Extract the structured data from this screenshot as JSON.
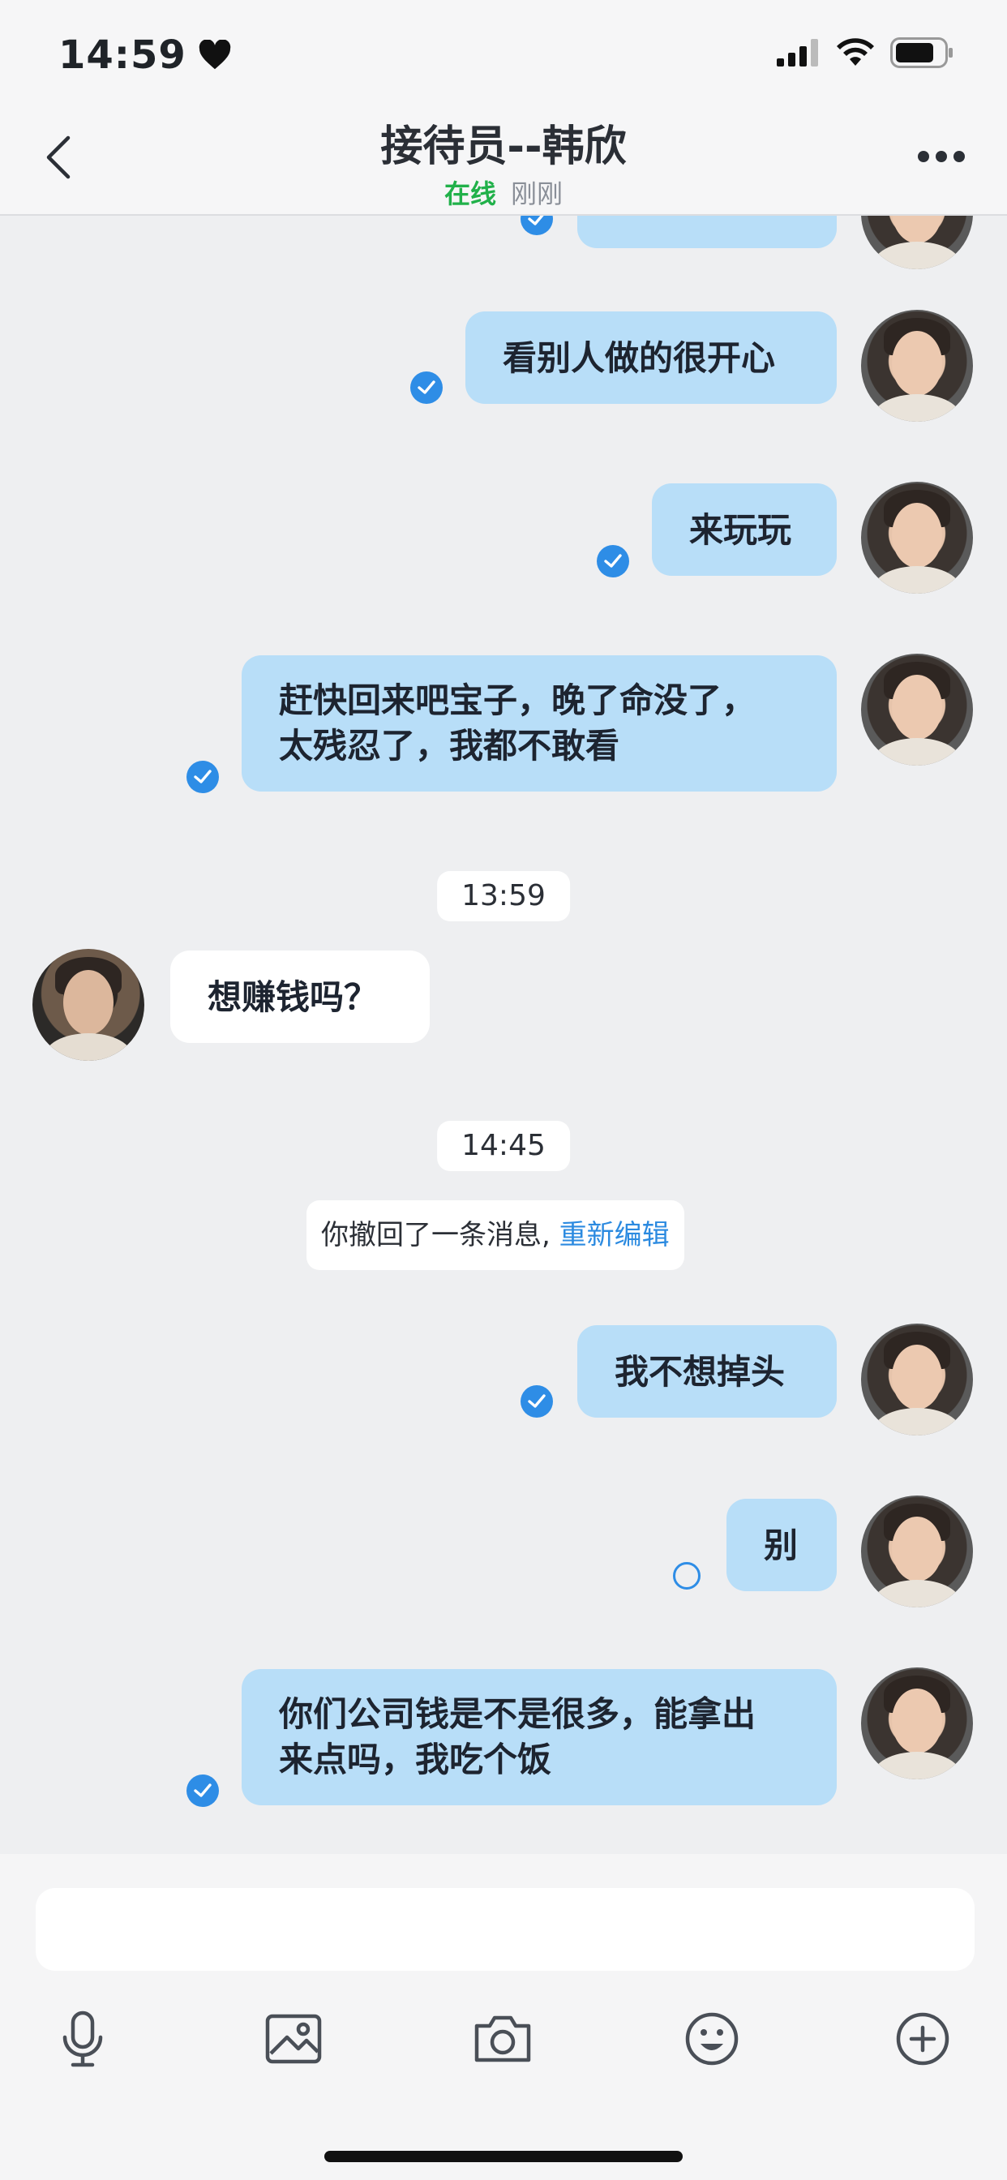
{
  "status_bar": {
    "time": "14:59"
  },
  "header": {
    "title": "接待员--韩欣",
    "status_online": "在线",
    "status_seen": "刚刚"
  },
  "messages": {
    "m1": "看别人做的很开心",
    "m2": "来玩玩",
    "m3_line1": "赶快回来吧宝子，晚了命没了，",
    "m3_line2": "太残忍了，我都不敢看",
    "t1": "13:59",
    "m4": "想赚钱吗？",
    "t2": "14:45",
    "notice_text": "你撤回了一条消息,",
    "notice_edit": "重新编辑",
    "m5": "我不想掉头",
    "m6": "别",
    "m7_line1": "你们公司钱是不是很多，能拿出",
    "m7_line2": "来点吗，我吃个饭"
  },
  "input": {
    "placeholder": ""
  },
  "toolbar": [
    "mic-icon",
    "image-icon",
    "camera-icon",
    "emoji-icon",
    "plus-icon"
  ],
  "colors": {
    "outgoing_bubble": "#b8def8",
    "incoming_bubble": "#ffffff",
    "accent": "#2e8de6",
    "online": "#21b14a"
  }
}
